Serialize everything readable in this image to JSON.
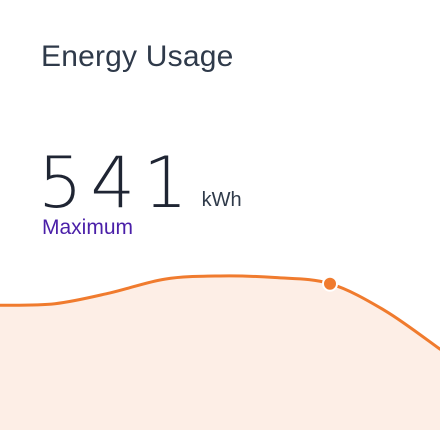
{
  "card": {
    "title": "Energy Usage",
    "value": "541",
    "unit": "kWh",
    "label": "Maximum"
  },
  "chart_data": {
    "type": "area",
    "x": [
      0,
      1,
      2,
      3,
      4,
      5,
      6,
      7,
      8
    ],
    "values": [
      0.62,
      0.64,
      0.78,
      0.96,
      1.0,
      0.98,
      0.9,
      0.55,
      0.05
    ],
    "highlight_index": 6,
    "colors": {
      "line": "#f07b2e",
      "fill": "#fdeee6",
      "marker": "#f07b2e"
    }
  }
}
